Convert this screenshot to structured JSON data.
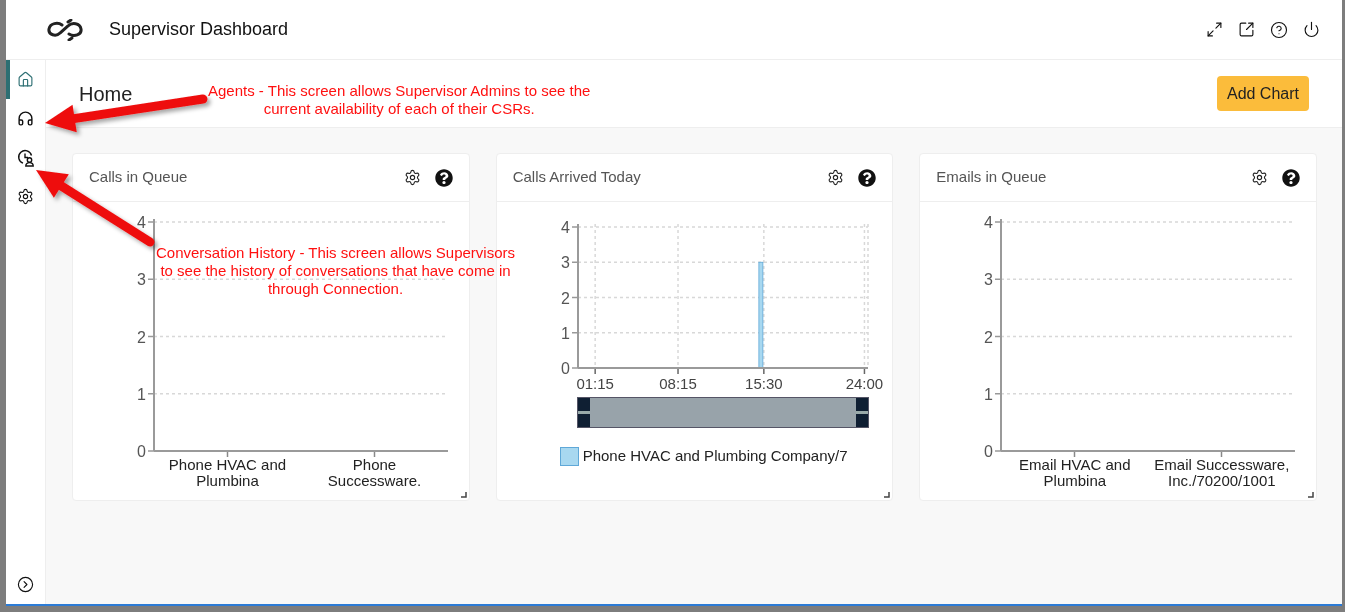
{
  "header": {
    "title": "Supervisor Dashboard"
  },
  "sidebar": {
    "items": [
      {
        "kind": "home",
        "selected": true
      },
      {
        "kind": "agents",
        "selected": false
      },
      {
        "kind": "history",
        "selected": false
      },
      {
        "kind": "settings",
        "selected": false
      }
    ]
  },
  "page": {
    "title": "Home",
    "add_button": "Add Chart"
  },
  "cards": [
    {
      "title": "Calls in Queue",
      "chart_data": {
        "type": "bar",
        "categories": [
          "Phone HVAC and Plumbina",
          "Phone Successware."
        ],
        "series": [
          {
            "color": "#a8d8f0",
            "values": [
              0,
              0
            ]
          }
        ],
        "ylim": [
          0,
          4
        ],
        "yticks": [
          0,
          1,
          2,
          3,
          4
        ],
        "grid": true
      }
    },
    {
      "title": "Calls Arrived Today",
      "chart_data": {
        "type": "bar",
        "x": [
          15.25
        ],
        "xlim": [
          -0.2,
          24.3
        ],
        "xticks": [
          {
            "value": 1.25,
            "label": "01:15"
          },
          {
            "value": 8.25,
            "label": "08:15"
          },
          {
            "value": 15.5,
            "label": "15:30"
          },
          {
            "value": 24,
            "label": "24:00"
          }
        ],
        "ylim": [
          0,
          4
        ],
        "yticks": [
          0,
          1,
          2,
          3,
          4
        ],
        "series": [
          {
            "name": "Phone HVAC and Plumbing Company/7",
            "color": "#a8d8f0",
            "values": [
              3
            ]
          }
        ],
        "grid": true
      }
    },
    {
      "title": "Emails in Queue",
      "chart_data": {
        "type": "bar",
        "categories": [
          "Email HVAC and Plumbina",
          "Email Successware, Inc./70200/1001"
        ],
        "series": [
          {
            "color": "#a8d8f0",
            "values": [
              0,
              0
            ]
          }
        ],
        "ylim": [
          0,
          4
        ],
        "yticks": [
          0,
          1,
          2,
          3,
          4
        ],
        "grid": true
      }
    }
  ],
  "annotations": [
    {
      "lines": [
        "Agents - This screen allows Supervisor Admins to see the",
        "current availability of each of their CSRs."
      ]
    },
    {
      "lines": [
        "Conversation History - This screen allows Supervisors",
        "to see the history of conversations that have come in",
        "through Connection."
      ]
    }
  ]
}
